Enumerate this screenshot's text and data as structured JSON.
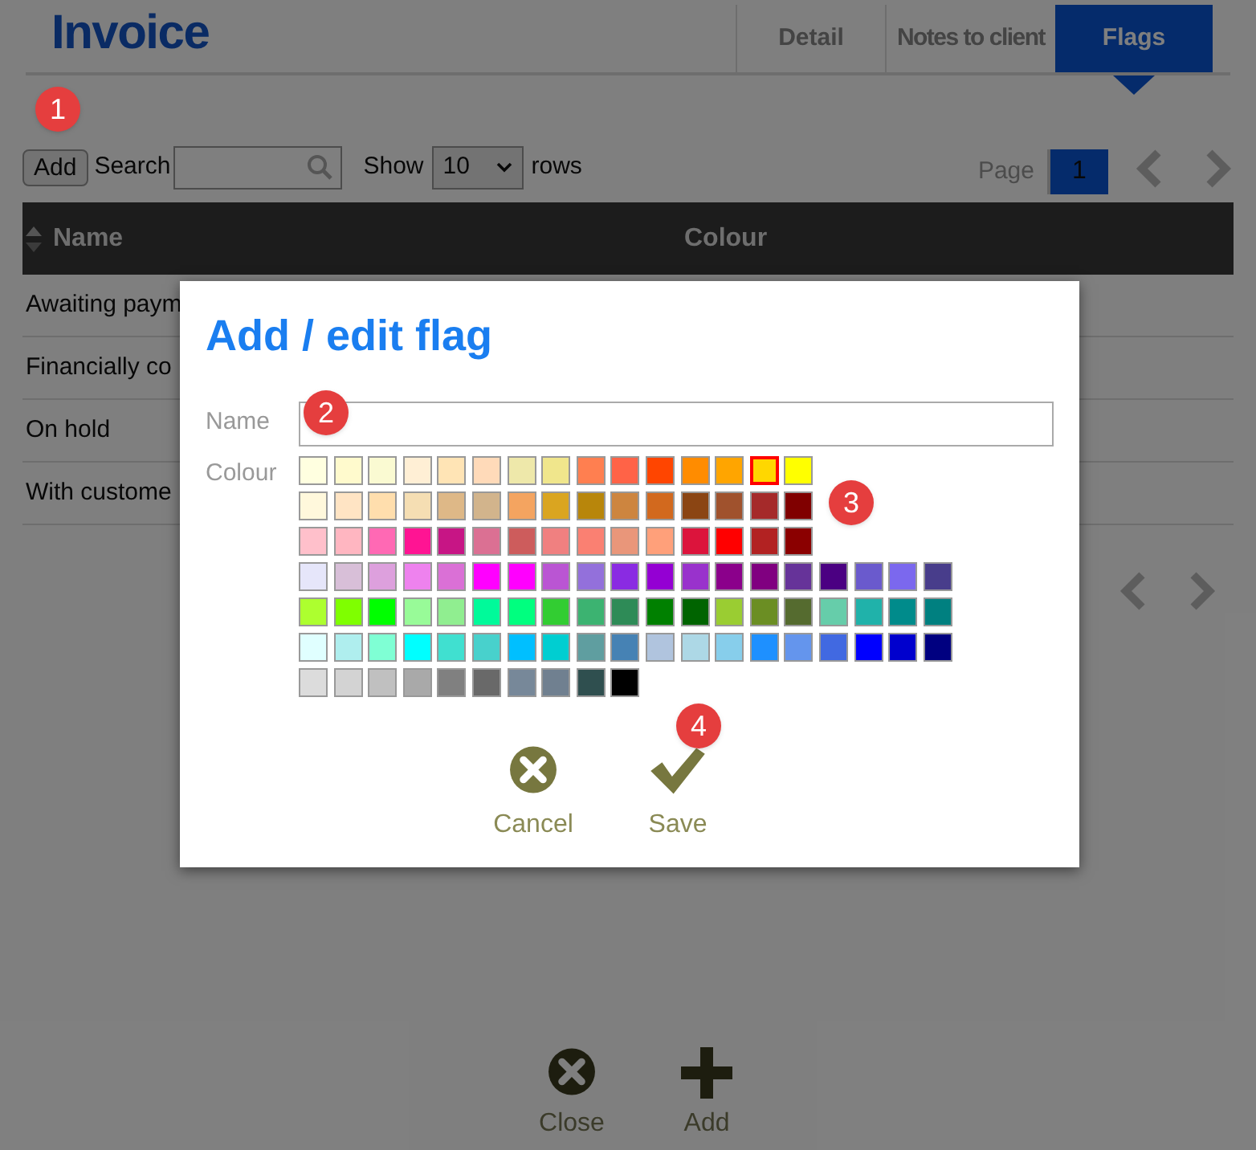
{
  "page": {
    "title": "Invoice",
    "tabs": [
      {
        "label": "Detail",
        "selected": false
      },
      {
        "label": "Notes to client",
        "selected": false
      },
      {
        "label": "Flags",
        "selected": true
      }
    ]
  },
  "toolbar": {
    "add_button": "Add",
    "search_label": "Search",
    "show_label": "Show",
    "rows_value": "10",
    "rows_label": "rows",
    "page_label": "Page",
    "current_page": "1"
  },
  "table": {
    "columns": [
      "Name",
      "Colour"
    ],
    "rows": [
      "Awaiting paym",
      "Financially co",
      "On hold",
      "With custome"
    ]
  },
  "footer_actions": [
    {
      "kind": "close",
      "label": "Close"
    },
    {
      "kind": "add",
      "label": "Add"
    }
  ],
  "dialog": {
    "title": "Add / edit flag",
    "name_label": "Name",
    "colour_label": "Colour",
    "colour_grid": [
      {
        "swatches": [
          {
            "color": "#ffffe0",
            "selected": false
          },
          {
            "color": "#fffacd",
            "selected": false
          },
          {
            "color": "#fafad2",
            "selected": false
          },
          {
            "color": "#ffefd5",
            "selected": false
          },
          {
            "color": "#ffe4b5",
            "selected": false
          },
          {
            "color": "#ffdab9",
            "selected": false
          },
          {
            "color": "#eee8aa",
            "selected": false
          },
          {
            "color": "#f0e68c",
            "selected": false
          },
          {
            "color": "#ff7f50",
            "selected": false
          },
          {
            "color": "#ff6347",
            "selected": false
          },
          {
            "color": "#ff4500",
            "selected": false
          },
          {
            "color": "#ff8c00",
            "selected": false
          },
          {
            "color": "#ffa500",
            "selected": false
          },
          {
            "color": "#ffd700",
            "selected": true
          },
          {
            "color": "#ffff00",
            "selected": false
          }
        ]
      },
      {
        "swatches": [
          {
            "color": "#fff8dc",
            "selected": false
          },
          {
            "color": "#ffe4c4",
            "selected": false
          },
          {
            "color": "#ffdead",
            "selected": false
          },
          {
            "color": "#f5deb3",
            "selected": false
          },
          {
            "color": "#deb887",
            "selected": false
          },
          {
            "color": "#d2b48c",
            "selected": false
          },
          {
            "color": "#f4a460",
            "selected": false
          },
          {
            "color": "#daa520",
            "selected": false
          },
          {
            "color": "#b8860b",
            "selected": false
          },
          {
            "color": "#cd853f",
            "selected": false
          },
          {
            "color": "#d2691e",
            "selected": false
          },
          {
            "color": "#8b4513",
            "selected": false
          },
          {
            "color": "#a0522d",
            "selected": false
          },
          {
            "color": "#a52a2a",
            "selected": false
          },
          {
            "color": "#800000",
            "selected": false
          }
        ]
      },
      {
        "swatches": [
          {
            "color": "#ffc0cb",
            "selected": false
          },
          {
            "color": "#ffb6c1",
            "selected": false
          },
          {
            "color": "#ff69b4",
            "selected": false
          },
          {
            "color": "#ff1493",
            "selected": false
          },
          {
            "color": "#c71585",
            "selected": false
          },
          {
            "color": "#db7093",
            "selected": false
          },
          {
            "color": "#cd5c5c",
            "selected": false
          },
          {
            "color": "#f08080",
            "selected": false
          },
          {
            "color": "#fa8072",
            "selected": false
          },
          {
            "color": "#e9967a",
            "selected": false
          },
          {
            "color": "#ffa07a",
            "selected": false
          },
          {
            "color": "#dc143c",
            "selected": false
          },
          {
            "color": "#ff0000",
            "selected": false
          },
          {
            "color": "#b22222",
            "selected": false
          },
          {
            "color": "#8b0000",
            "selected": false
          }
        ]
      },
      {
        "swatches": [
          {
            "color": "#e6e6fa",
            "selected": false
          },
          {
            "color": "#d8bfd8",
            "selected": false
          },
          {
            "color": "#dda0dd",
            "selected": false
          },
          {
            "color": "#ee82ee",
            "selected": false
          },
          {
            "color": "#da70d6",
            "selected": false
          },
          {
            "color": "#ff00ff",
            "selected": false
          },
          {
            "color": "#ff00fe",
            "selected": false
          },
          {
            "color": "#ba55d3",
            "selected": false
          },
          {
            "color": "#9370db",
            "selected": false
          },
          {
            "color": "#8a2be2",
            "selected": false
          },
          {
            "color": "#9400d3",
            "selected": false
          },
          {
            "color": "#9932cc",
            "selected": false
          },
          {
            "color": "#8b008b",
            "selected": false
          },
          {
            "color": "#800080",
            "selected": false
          },
          {
            "color": "#663399",
            "selected": false
          },
          {
            "color": "#4b0082",
            "selected": false
          },
          {
            "color": "#6a5acd",
            "selected": false
          },
          {
            "color": "#7b68ee",
            "selected": false
          },
          {
            "color": "#483d8b",
            "selected": false
          }
        ]
      },
      {
        "swatches": [
          {
            "color": "#adff2f",
            "selected": false
          },
          {
            "color": "#7fff00",
            "selected": false
          },
          {
            "color": "#00ff00",
            "selected": false
          },
          {
            "color": "#98fb98",
            "selected": false
          },
          {
            "color": "#90ee90",
            "selected": false
          },
          {
            "color": "#00fa9a",
            "selected": false
          },
          {
            "color": "#00ff7f",
            "selected": false
          },
          {
            "color": "#32cd32",
            "selected": false
          },
          {
            "color": "#3cb371",
            "selected": false
          },
          {
            "color": "#2e8b57",
            "selected": false
          },
          {
            "color": "#008000",
            "selected": false
          },
          {
            "color": "#006400",
            "selected": false
          },
          {
            "color": "#9acd32",
            "selected": false
          },
          {
            "color": "#6b8e23",
            "selected": false
          },
          {
            "color": "#556b2f",
            "selected": false
          },
          {
            "color": "#66cdaa",
            "selected": false
          },
          {
            "color": "#20b2aa",
            "selected": false
          },
          {
            "color": "#008b8b",
            "selected": false
          },
          {
            "color": "#008080",
            "selected": false
          }
        ]
      },
      {
        "swatches": [
          {
            "color": "#e0ffff",
            "selected": false
          },
          {
            "color": "#afeeee",
            "selected": false
          },
          {
            "color": "#7fffd4",
            "selected": false
          },
          {
            "color": "#00ffff",
            "selected": false
          },
          {
            "color": "#40e0d0",
            "selected": false
          },
          {
            "color": "#48d1cc",
            "selected": false
          },
          {
            "color": "#00bfff",
            "selected": false
          },
          {
            "color": "#00ced1",
            "selected": false
          },
          {
            "color": "#5f9ea0",
            "selected": false
          },
          {
            "color": "#4682b4",
            "selected": false
          },
          {
            "color": "#b0c4de",
            "selected": false
          },
          {
            "color": "#add8e6",
            "selected": false
          },
          {
            "color": "#87ceeb",
            "selected": false
          },
          {
            "color": "#1e90ff",
            "selected": false
          },
          {
            "color": "#6495ed",
            "selected": false
          },
          {
            "color": "#4169e1",
            "selected": false
          },
          {
            "color": "#0000ff",
            "selected": false
          },
          {
            "color": "#0000cd",
            "selected": false
          },
          {
            "color": "#000080",
            "selected": false
          }
        ]
      },
      {
        "swatches": [
          {
            "color": "#dcdcdc",
            "selected": false
          },
          {
            "color": "#d3d3d3",
            "selected": false
          },
          {
            "color": "#c0c0c0",
            "selected": false
          },
          {
            "color": "#a9a9a9",
            "selected": false
          },
          {
            "color": "#808080",
            "selected": false
          },
          {
            "color": "#696969",
            "selected": false
          },
          {
            "color": "#778899",
            "selected": false
          },
          {
            "color": "#708090",
            "selected": false
          },
          {
            "color": "#2f4f4f",
            "selected": false
          },
          {
            "color": "#000000",
            "selected": false
          }
        ]
      }
    ],
    "actions": [
      {
        "kind": "cancel",
        "label": "Cancel"
      },
      {
        "kind": "save",
        "label": "Save"
      }
    ]
  },
  "callouts": [
    "1",
    "2",
    "3",
    "4"
  ]
}
